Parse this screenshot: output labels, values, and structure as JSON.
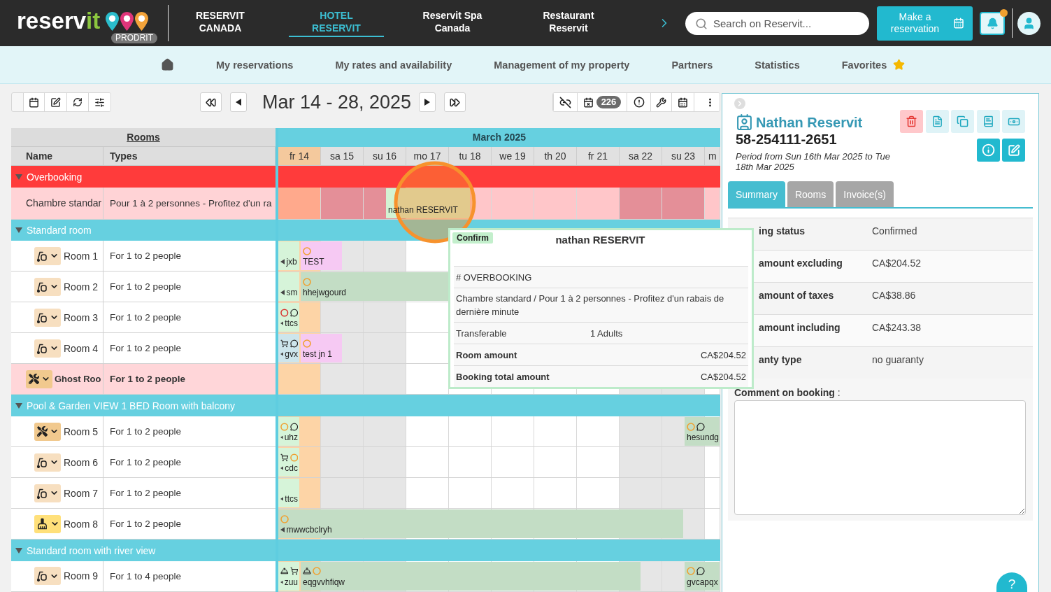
{
  "header": {
    "logo": {
      "name": "reserv",
      "accent": "it",
      "badge": "PRODRIT"
    },
    "properties": [
      {
        "label": "RESERVIT CANADA",
        "selected": false
      },
      {
        "label": "HOTEL RESERVIT",
        "selected": true
      },
      {
        "label": "Reservit Spa Canada",
        "selected": false
      },
      {
        "label": "Restaurant Reservit",
        "selected": false
      }
    ],
    "search": {
      "placeholder": "Search on Reservit..."
    },
    "reserve_button": "Make a reservation",
    "notifications": {
      "unread": true
    }
  },
  "menu": [
    {
      "kind": "home"
    },
    {
      "kind": "link",
      "label": "My reservations"
    },
    {
      "kind": "link",
      "label": "My rates and availability"
    },
    {
      "kind": "link",
      "label": "Management of my property"
    },
    {
      "kind": "link",
      "label": "Partners"
    },
    {
      "kind": "link",
      "label": "Statistics"
    },
    {
      "kind": "favorites",
      "label": "Favorites"
    }
  ],
  "toolbar": {
    "title": "Mar 14 - 28, 2025",
    "pending_count": "226"
  },
  "grid": {
    "rooms_heading": "Rooms",
    "columns": [
      "Name",
      "Types"
    ],
    "month": "March 2025",
    "days": [
      {
        "label": "fr 14",
        "today": true,
        "weekend": false
      },
      {
        "label": "sa 15",
        "today": false,
        "weekend": true
      },
      {
        "label": "su 16",
        "today": false,
        "weekend": true
      },
      {
        "label": "mo 17",
        "today": false,
        "weekend": false
      },
      {
        "label": "tu 18",
        "today": false,
        "weekend": false
      },
      {
        "label": "we 19",
        "today": false,
        "weekend": false
      },
      {
        "label": "th 20",
        "today": false,
        "weekend": false
      },
      {
        "label": "fr 21",
        "today": false,
        "weekend": false
      },
      {
        "label": "sa 22",
        "today": false,
        "weekend": true
      },
      {
        "label": "su 23",
        "today": false,
        "weekend": true
      },
      {
        "label": "m",
        "today": false,
        "weekend": false
      }
    ],
    "groups": [
      {
        "name": "Overbooking",
        "kind": "overbooking",
        "expanded": true,
        "rows": [
          {
            "kind": "overbooking",
            "name": "Chambre standar",
            "type": "Pour 1 à 2 personnes - Profitez d'un ra",
            "slots": [
              {
                "kind": "free"
              },
              {
                "kind": "free"
              },
              {
                "kind": "free"
              },
              {
                "kind": "free"
              },
              {
                "kind": "free"
              },
              {
                "kind": "start",
                "label": "nathan RESERVIT",
                "color": "#d3f3d3"
              },
              {
                "kind": "stay"
              },
              {
                "kind": "stay"
              },
              {
                "kind": "stay"
              },
              {
                "kind": "free"
              },
              {
                "kind": "free"
              },
              {
                "kind": "free"
              },
              {
                "kind": "free"
              },
              {
                "kind": "free"
              },
              {
                "kind": "free"
              },
              {
                "kind": "free"
              },
              {
                "kind": "free"
              },
              {
                "kind": "free"
              },
              {
                "kind": "free"
              },
              {
                "kind": "free"
              },
              {
                "kind": "free"
              },
              {
                "kind": "free"
              }
            ]
          }
        ]
      },
      {
        "name": "Standard room",
        "kind": "category",
        "expanded": true,
        "rows": [
          {
            "kind": "room",
            "housekeeping": {
              "kind": "to_clean"
            },
            "name": "Room 1",
            "type": "For 1 to 2 people",
            "slots": [
              {
                "kind": "start",
                "label": "jxb",
                "color": "#d6f4d9"
              },
              {
                "kind": "start",
                "label": "TEST",
                "color": "#f6c9f3",
                "flags": [
                  {
                    "kind": "ring",
                    "color": "#f0a030"
                  }
                ]
              },
              {
                "kind": "stay"
              },
              {
                "kind": "free"
              },
              {
                "kind": "free"
              },
              {
                "kind": "free"
              },
              {
                "kind": "free"
              },
              {
                "kind": "free"
              },
              {
                "kind": "free"
              },
              {
                "kind": "free"
              },
              {
                "kind": "free"
              },
              {
                "kind": "free"
              },
              {
                "kind": "free"
              },
              {
                "kind": "free"
              },
              {
                "kind": "free"
              },
              {
                "kind": "free"
              },
              {
                "kind": "free"
              },
              {
                "kind": "free"
              },
              {
                "kind": "free"
              },
              {
                "kind": "free"
              },
              {
                "kind": "free"
              },
              {
                "kind": "free"
              }
            ]
          },
          {
            "kind": "room",
            "housekeeping": {
              "kind": "to_clean"
            },
            "name": "Room 2",
            "type": "For 1 to 2 people",
            "slots": [
              {
                "kind": "start",
                "label": "sm",
                "color": "#d6f4d9"
              },
              {
                "kind": "start",
                "label": "hhejwgourd",
                "color": "#c3ddc5",
                "flags": [
                  {
                    "kind": "ring",
                    "color": "#f0a030"
                  }
                ]
              },
              {
                "kind": "stay"
              },
              {
                "kind": "stay"
              },
              {
                "kind": "stay"
              },
              {
                "kind": "stay"
              },
              {
                "kind": "stay"
              },
              {
                "kind": "stay"
              },
              {
                "kind": "stay"
              },
              {
                "kind": "stay"
              },
              {
                "kind": "stay"
              },
              {
                "kind": "stay"
              },
              {
                "kind": "free"
              },
              {
                "kind": "free"
              },
              {
                "kind": "free"
              },
              {
                "kind": "free"
              },
              {
                "kind": "free"
              },
              {
                "kind": "free"
              },
              {
                "kind": "free"
              },
              {
                "kind": "free"
              },
              {
                "kind": "free"
              },
              {
                "kind": "free"
              }
            ]
          },
          {
            "kind": "room",
            "housekeeping": {
              "kind": "to_clean"
            },
            "name": "Room 3",
            "type": "For 1 to 2 people",
            "slots": [
              {
                "kind": "start",
                "label": "ttcs",
                "color": "#d6f4d9",
                "flags": [
                  {
                    "kind": "ring",
                    "color": "#d9302c"
                  },
                  {
                    "kind": "comment"
                  }
                ]
              },
              {
                "kind": "free"
              },
              {
                "kind": "free"
              },
              {
                "kind": "free"
              },
              {
                "kind": "free"
              },
              {
                "kind": "free"
              },
              {
                "kind": "free"
              },
              {
                "kind": "free"
              },
              {
                "kind": "free"
              },
              {
                "kind": "free"
              },
              {
                "kind": "free"
              },
              {
                "kind": "free"
              },
              {
                "kind": "free"
              },
              {
                "kind": "free"
              },
              {
                "kind": "free"
              },
              {
                "kind": "free"
              },
              {
                "kind": "free"
              },
              {
                "kind": "free"
              },
              {
                "kind": "free"
              },
              {
                "kind": "free"
              },
              {
                "kind": "free"
              },
              {
                "kind": "free"
              }
            ]
          },
          {
            "kind": "room",
            "housekeeping": {
              "kind": "to_clean"
            },
            "name": "Room 4",
            "type": "For 1 to 2 people",
            "slots": [
              {
                "kind": "start",
                "label": "gvx",
                "color": "#cde5ec",
                "flags": [
                  {
                    "kind": "cart"
                  },
                  {
                    "kind": "comment"
                  }
                ]
              },
              {
                "kind": "start",
                "label": "test jn 1",
                "color": "#f6c9f3",
                "flags": [
                  {
                    "kind": "ring",
                    "color": "#f0a030"
                  }
                ]
              },
              {
                "kind": "stay"
              },
              {
                "kind": "free"
              },
              {
                "kind": "free"
              },
              {
                "kind": "free"
              },
              {
                "kind": "free"
              },
              {
                "kind": "free"
              },
              {
                "kind": "free"
              },
              {
                "kind": "free"
              },
              {
                "kind": "free"
              },
              {
                "kind": "free"
              },
              {
                "kind": "free"
              },
              {
                "kind": "free"
              },
              {
                "kind": "free"
              },
              {
                "kind": "free"
              },
              {
                "kind": "free"
              },
              {
                "kind": "free"
              },
              {
                "kind": "free"
              },
              {
                "kind": "free"
              },
              {
                "kind": "free"
              },
              {
                "kind": "free"
              }
            ]
          },
          {
            "kind": "ghost",
            "housekeeping": {
              "kind": "maintenance"
            },
            "name": "Ghost Roo",
            "type": "For 1 to 2 people",
            "slots": [
              {
                "kind": "free"
              },
              {
                "kind": "free"
              },
              {
                "kind": "free"
              },
              {
                "kind": "free"
              },
              {
                "kind": "free"
              },
              {
                "kind": "free"
              },
              {
                "kind": "free"
              },
              {
                "kind": "free"
              },
              {
                "kind": "free"
              },
              {
                "kind": "free"
              },
              {
                "kind": "free"
              },
              {
                "kind": "free"
              },
              {
                "kind": "free"
              },
              {
                "kind": "free"
              },
              {
                "kind": "free"
              },
              {
                "kind": "free"
              },
              {
                "kind": "free"
              },
              {
                "kind": "free"
              },
              {
                "kind": "free"
              },
              {
                "kind": "free"
              },
              {
                "kind": "free"
              },
              {
                "kind": "free"
              }
            ]
          }
        ]
      },
      {
        "name": "Pool & Garden VIEW 1 BED Room with balcony",
        "kind": "category",
        "expanded": true,
        "rows": [
          {
            "kind": "room",
            "housekeeping": {
              "kind": "maintenance"
            },
            "name": "Room 5",
            "type": "For 1 to 2 people",
            "slots": [
              {
                "kind": "start",
                "label": "uhz",
                "color": "#d6f4d9",
                "flags": [
                  {
                    "kind": "ring",
                    "color": "#f0a030"
                  },
                  {
                    "kind": "comment"
                  }
                ]
              },
              {
                "kind": "free"
              },
              {
                "kind": "free"
              },
              {
                "kind": "free"
              },
              {
                "kind": "free"
              },
              {
                "kind": "free"
              },
              {
                "kind": "free"
              },
              {
                "kind": "free"
              },
              {
                "kind": "free"
              },
              {
                "kind": "free"
              },
              {
                "kind": "free"
              },
              {
                "kind": "free"
              },
              {
                "kind": "free"
              },
              {
                "kind": "free"
              },
              {
                "kind": "free"
              },
              {
                "kind": "free"
              },
              {
                "kind": "free"
              },
              {
                "kind": "free"
              },
              {
                "kind": "free"
              },
              {
                "kind": "start",
                "label": "hesundg",
                "color": "#c3ddc5",
                "flags": [
                  {
                    "kind": "ring",
                    "color": "#f0a030"
                  },
                  {
                    "kind": "comment"
                  }
                ]
              },
              {
                "kind": "stay"
              },
              {
                "kind": "stay"
              }
            ]
          },
          {
            "kind": "room",
            "housekeeping": {
              "kind": "to_clean"
            },
            "name": "Room 6",
            "type": "For 1 to 2 people",
            "slots": [
              {
                "kind": "start",
                "label": "cdc",
                "color": "#d6f4d9",
                "flags": [
                  {
                    "kind": "cart"
                  },
                  {
                    "kind": "ring",
                    "color": "#f0a030"
                  }
                ]
              },
              {
                "kind": "free"
              },
              {
                "kind": "free"
              },
              {
                "kind": "free"
              },
              {
                "kind": "free"
              },
              {
                "kind": "free"
              },
              {
                "kind": "free"
              },
              {
                "kind": "free"
              },
              {
                "kind": "free"
              },
              {
                "kind": "free"
              },
              {
                "kind": "free"
              },
              {
                "kind": "free"
              },
              {
                "kind": "free"
              },
              {
                "kind": "free"
              },
              {
                "kind": "free"
              },
              {
                "kind": "free"
              },
              {
                "kind": "free"
              },
              {
                "kind": "free"
              },
              {
                "kind": "free"
              },
              {
                "kind": "free"
              },
              {
                "kind": "free"
              },
              {
                "kind": "free"
              }
            ]
          },
          {
            "kind": "room",
            "housekeeping": {
              "kind": "to_clean"
            },
            "name": "Room 7",
            "type": "For 1 to 2 people",
            "slots": [
              {
                "kind": "start",
                "label": "ttcs",
                "color": "#d6f4d9"
              },
              {
                "kind": "free"
              },
              {
                "kind": "free"
              },
              {
                "kind": "free"
              },
              {
                "kind": "free"
              },
              {
                "kind": "free"
              },
              {
                "kind": "free"
              },
              {
                "kind": "free"
              },
              {
                "kind": "free"
              },
              {
                "kind": "free"
              },
              {
                "kind": "free"
              },
              {
                "kind": "free"
              },
              {
                "kind": "free"
              },
              {
                "kind": "free"
              },
              {
                "kind": "free"
              },
              {
                "kind": "free"
              },
              {
                "kind": "free"
              },
              {
                "kind": "free"
              },
              {
                "kind": "free"
              },
              {
                "kind": "free"
              },
              {
                "kind": "free"
              },
              {
                "kind": "free"
              }
            ]
          },
          {
            "kind": "room",
            "housekeeping": {
              "kind": "in_progress"
            },
            "name": "Room 8",
            "type": "For 1 to 2 people",
            "slots": [
              {
                "kind": "start",
                "label": "mwwcbclryh",
                "color": "#c3ddc5",
                "flags": [
                  {
                    "kind": "ring",
                    "color": "#f0a030"
                  }
                ]
              },
              {
                "kind": "stay"
              },
              {
                "kind": "stay"
              },
              {
                "kind": "stay"
              },
              {
                "kind": "stay"
              },
              {
                "kind": "stay"
              },
              {
                "kind": "stay"
              },
              {
                "kind": "stay"
              },
              {
                "kind": "stay"
              },
              {
                "kind": "stay"
              },
              {
                "kind": "stay"
              },
              {
                "kind": "stay"
              },
              {
                "kind": "stay"
              },
              {
                "kind": "stay"
              },
              {
                "kind": "stay"
              },
              {
                "kind": "stay"
              },
              {
                "kind": "stay"
              },
              {
                "kind": "stay"
              },
              {
                "kind": "stay"
              },
              {
                "kind": "free"
              },
              {
                "kind": "free"
              },
              {
                "kind": "free"
              }
            ]
          }
        ]
      },
      {
        "name": "Standard room with river view",
        "kind": "category",
        "expanded": true,
        "rows": [
          {
            "kind": "room",
            "housekeeping": {
              "kind": "to_clean"
            },
            "name": "Room 9",
            "type": "For 1 to 4 people",
            "slots": [
              {
                "kind": "start",
                "label": "zuu",
                "color": "#d6f4d9",
                "flags": [
                  {
                    "kind": "bell"
                  },
                  {
                    "kind": "cart"
                  }
                ]
              },
              {
                "kind": "start",
                "label": "eqgvvhfiqw",
                "color": "#c3ddc5",
                "flags": [
                  {
                    "kind": "bell"
                  },
                  {
                    "kind": "ring",
                    "color": "#f0a030"
                  }
                ]
              },
              {
                "kind": "stay"
              },
              {
                "kind": "stay"
              },
              {
                "kind": "stay"
              },
              {
                "kind": "stay"
              },
              {
                "kind": "stay"
              },
              {
                "kind": "stay"
              },
              {
                "kind": "stay"
              },
              {
                "kind": "stay"
              },
              {
                "kind": "stay"
              },
              {
                "kind": "stay"
              },
              {
                "kind": "stay"
              },
              {
                "kind": "stay"
              },
              {
                "kind": "stay"
              },
              {
                "kind": "stay"
              },
              {
                "kind": "stay"
              },
              {
                "kind": "free"
              },
              {
                "kind": "free"
              },
              {
                "kind": "start",
                "label": "gvcapqx",
                "color": "#c3ddc5",
                "flags": [
                  {
                    "kind": "ring",
                    "color": "#f0a030"
                  },
                  {
                    "kind": "comment"
                  }
                ]
              },
              {
                "kind": "stay"
              },
              {
                "kind": "stay"
              }
            ]
          }
        ]
      }
    ]
  },
  "booking_tooltip": {
    "status": "Confirm",
    "guest": "nathan RESERVIT",
    "rows": [
      {
        "kind": "text",
        "text": "# OVERBOOKING"
      },
      {
        "kind": "text",
        "text": "Chambre standard / Pour 1 à 2 personnes - Profitez d'un rabais de dernière minute"
      },
      {
        "kind": "pair",
        "label": "Transferable",
        "value": "1 Adults"
      },
      {
        "kind": "amount",
        "label": "Room amount",
        "value": "CA$204.52"
      },
      {
        "kind": "amount",
        "label": "Booking total amount",
        "value": "CA$204.52"
      }
    ]
  },
  "booking_panel": {
    "guest": "Nathan Reservit",
    "reference": "58-254111-2651",
    "period": "Period from Sun 16th Mar 2025 to Tue 18th Mar 2025",
    "tabs": [
      {
        "label": "Summary",
        "selected": true
      },
      {
        "label": "Rooms",
        "selected": false
      },
      {
        "label": "Invoice(s)",
        "selected": false
      }
    ],
    "summary": [
      {
        "label": "ing status",
        "value": "Confirmed"
      },
      {
        "label": "amount excluding",
        "value": "CA$204.52"
      },
      {
        "label": "amount of taxes",
        "value": "CA$38.86"
      },
      {
        "label": "amount including",
        "value": "CA$243.38"
      },
      {
        "label": "anty type",
        "value": "no guaranty"
      }
    ],
    "comment_label": "**Comment on booking** :"
  },
  "help_button": "?"
}
